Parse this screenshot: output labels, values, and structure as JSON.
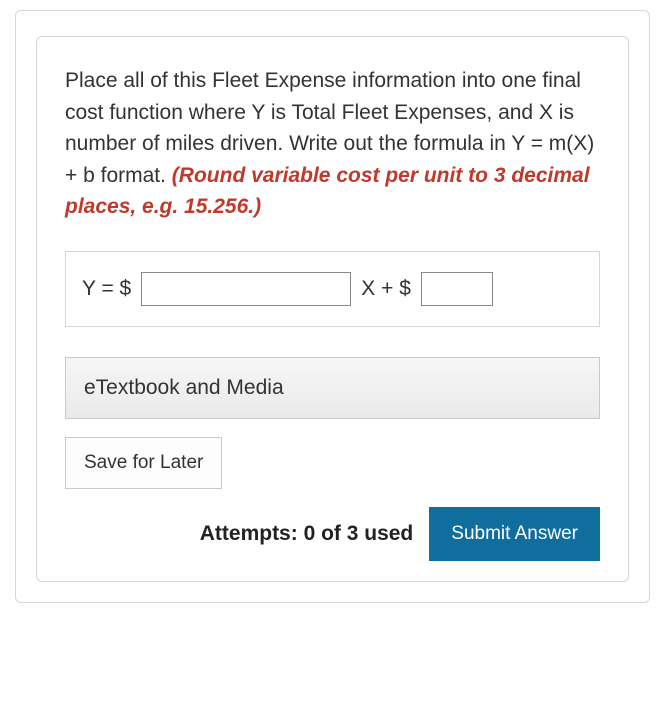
{
  "question": {
    "text_main": "Place all of this Fleet Expense information into one final cost function where Y is Total Fleet Expenses, and X is number of miles driven. Write out the formula in Y = m(X) + b format. ",
    "text_red": "(Round variable cost per unit to 3 decimal places, e.g. 15.256.)"
  },
  "formula": {
    "prefix": "Y = $",
    "middle": "X + $",
    "input_m_value": "",
    "input_b_value": ""
  },
  "buttons": {
    "etextbook": "eTextbook and Media",
    "save": "Save for Later",
    "submit": "Submit Answer"
  },
  "attempts": {
    "label": "Attempts: 0 of 3 used"
  }
}
